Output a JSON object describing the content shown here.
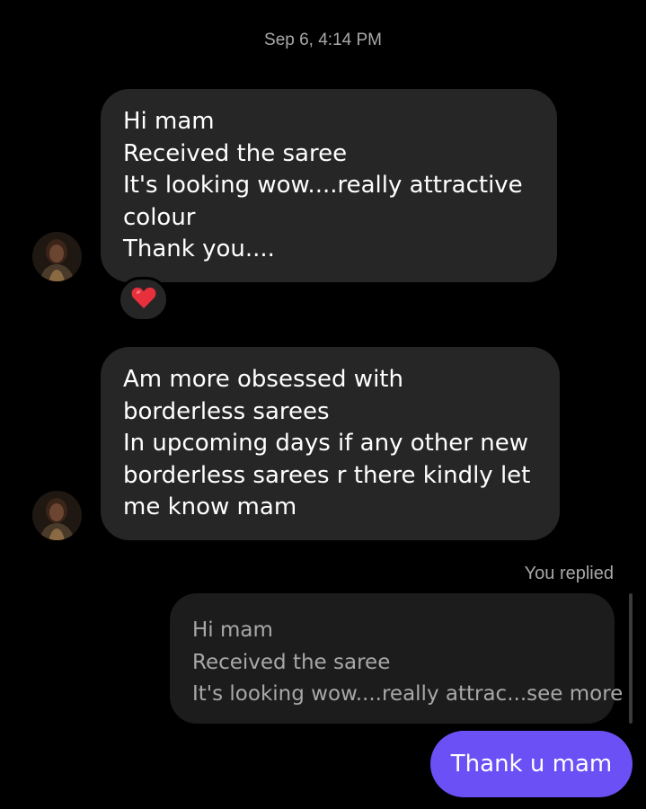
{
  "thread": {
    "timestamp": "Sep 6, 4:14 PM"
  },
  "messages": [
    {
      "direction": "incoming",
      "lines": [
        "Hi mam",
        "Received the saree",
        "It's looking wow....really attractive",
        "colour",
        "Thank you...."
      ],
      "reaction": "heart"
    },
    {
      "direction": "incoming",
      "lines": [
        "Am more obsessed with",
        "borderless sarees",
        "In upcoming days if any other new",
        "borderless sarees r there kindly let",
        "me know mam"
      ]
    }
  ],
  "reply": {
    "label": "You replied",
    "quoted_lines": [
      "Hi mam",
      "Received the saree",
      "It's looking wow....really attrac...see more"
    ],
    "message": "Thank u mam"
  },
  "colors": {
    "background": "#000000",
    "incoming_bubble": "#262626",
    "outgoing_bubble": "#6a50f5",
    "reaction_heart": "#e8303c"
  }
}
